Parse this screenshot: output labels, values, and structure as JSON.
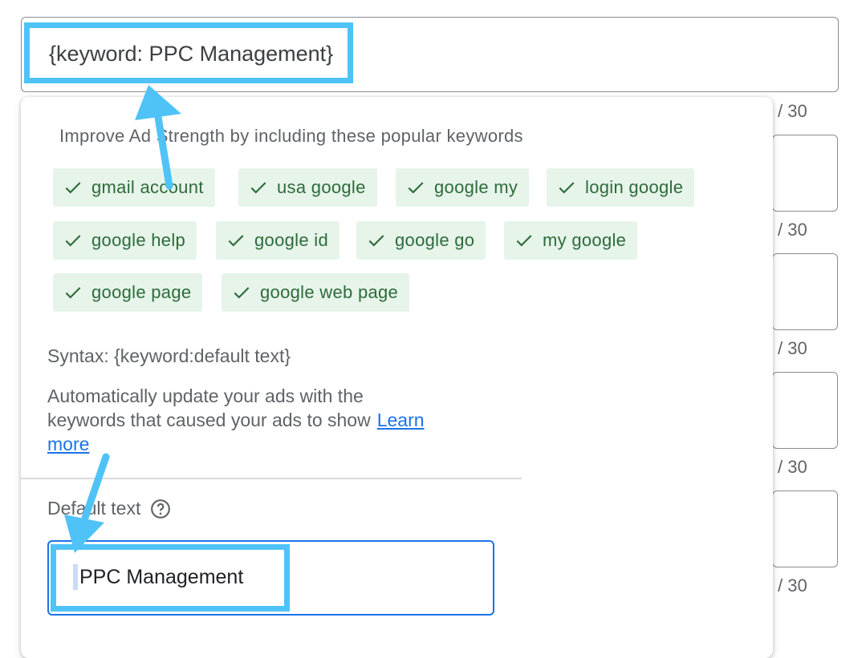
{
  "form": {
    "headline_value": "{keyword: PPC Management}",
    "counters": [
      "/ 30",
      "/ 30",
      "/ 30",
      "/ 30",
      "/ 30"
    ]
  },
  "popup": {
    "title": "Improve Ad Strength by including these popular keywords",
    "keywords": [
      "gmail account",
      "usa google",
      "google my",
      "login google",
      "google help",
      "google id",
      "google go",
      "my google",
      "google page",
      "google web page"
    ],
    "syntax": "Syntax: {keyword:default text}",
    "description": "Automatically update your ads with the keywords that caused your ads to show",
    "learn_more": "Learn more",
    "default_label": "Default text",
    "default_value": "PPC Management"
  },
  "colors": {
    "chip_bg": "#e6f4ea",
    "chip_text": "#2e6b3a",
    "link": "#1a73e8",
    "highlight": "#4fc3f7",
    "focus_border": "#1a73e8"
  },
  "icons": {
    "chip": "check-icon",
    "help": "help-circle-icon"
  }
}
